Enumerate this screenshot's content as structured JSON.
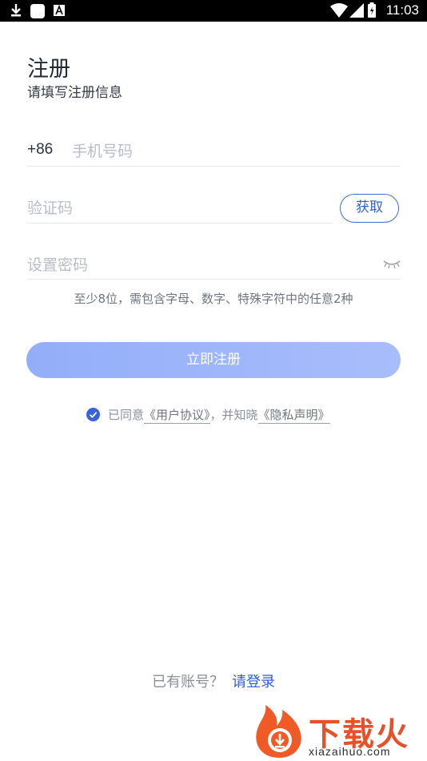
{
  "status_bar": {
    "time": "11:03",
    "icons": [
      "download-icon",
      "app-icon",
      "font-icon",
      "wifi-icon",
      "signal-icon",
      "battery-icon"
    ]
  },
  "header": {
    "title": "注册",
    "subtitle": "请填写注册信息"
  },
  "form": {
    "phone_prefix": "+86",
    "phone_placeholder": "手机号码",
    "code_placeholder": "验证码",
    "get_code_label": "获取",
    "password_placeholder": "设置密码",
    "password_hint": "至少8位，需包含字母、数字、特殊字符中的任意2种"
  },
  "register_button": "立即注册",
  "agreement": {
    "prefix": "已同意",
    "user_agreement": "《用户协议》",
    "middle": "，并知晓",
    "privacy_policy": "《隐私声明》",
    "checked": true
  },
  "footer": {
    "have_account": "已有账号？",
    "login_link": "请登录"
  },
  "watermark": {
    "text": "下载火",
    "url": "xiazaihuo.com"
  },
  "colors": {
    "accent": "#2f5ed6",
    "button": "#9db4fa",
    "watermark": "#e8502a"
  }
}
